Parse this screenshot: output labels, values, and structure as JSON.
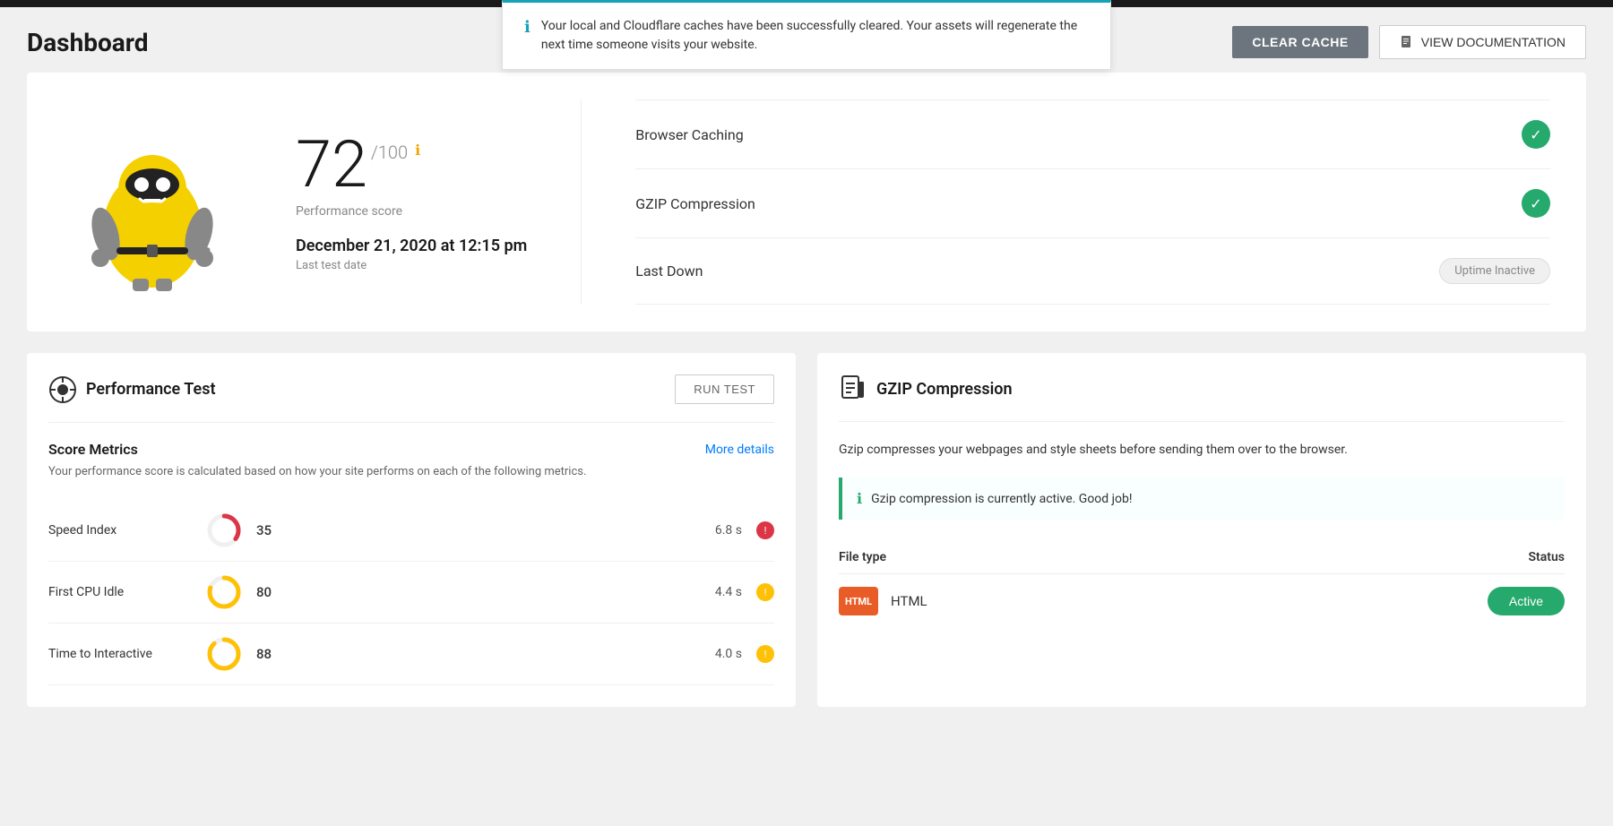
{
  "topbar": {},
  "notification": {
    "text": "Your local and Cloudflare caches have been successfully cleared. Your assets will regenerate the next time someone visits your website."
  },
  "header": {
    "title": "Dashboard",
    "clear_cache_label": "CLEAR CACHE",
    "view_docs_label": "VIEW DOCUMENTATION"
  },
  "score_card": {
    "score": "72",
    "denom": "/100",
    "score_label": "Performance score",
    "date": "December 21, 2020 at 12:15 pm",
    "date_label": "Last test date"
  },
  "status_items": [
    {
      "label": "Browser Caching",
      "status": "check"
    },
    {
      "label": "GZIP Compression",
      "status": "check"
    },
    {
      "label": "Last Down",
      "status": "inactive",
      "badge": "Uptime Inactive"
    }
  ],
  "performance_panel": {
    "title": "Performance Test",
    "run_test_label": "RUN TEST",
    "metrics_title": "Score Metrics",
    "metrics_link": "More details",
    "metrics_desc": "Your performance score is calculated based on how your site performs on each of the following metrics.",
    "metrics": [
      {
        "name": "Speed Index",
        "score": 35,
        "time": "6.8 s",
        "color": "#dc3545",
        "percent": 35,
        "status": "red"
      },
      {
        "name": "First CPU Idle",
        "score": 80,
        "time": "4.4 s",
        "color": "#ffc107",
        "percent": 80,
        "status": "yellow"
      },
      {
        "name": "Time to Interactive",
        "score": 88,
        "time": "4.0 s",
        "color": "#ffc107",
        "percent": 88,
        "status": "yellow"
      }
    ]
  },
  "gzip_panel": {
    "title": "GZIP Compression",
    "description": "Gzip compresses your webpages and style sheets before sending them over to the browser.",
    "alert_text": "Gzip compression is currently active. Good job!",
    "file_type_col": "File type",
    "status_col": "Status",
    "files": [
      {
        "type": "HTML",
        "badge": "HTML",
        "status_label": "Active",
        "status": "active"
      }
    ]
  }
}
